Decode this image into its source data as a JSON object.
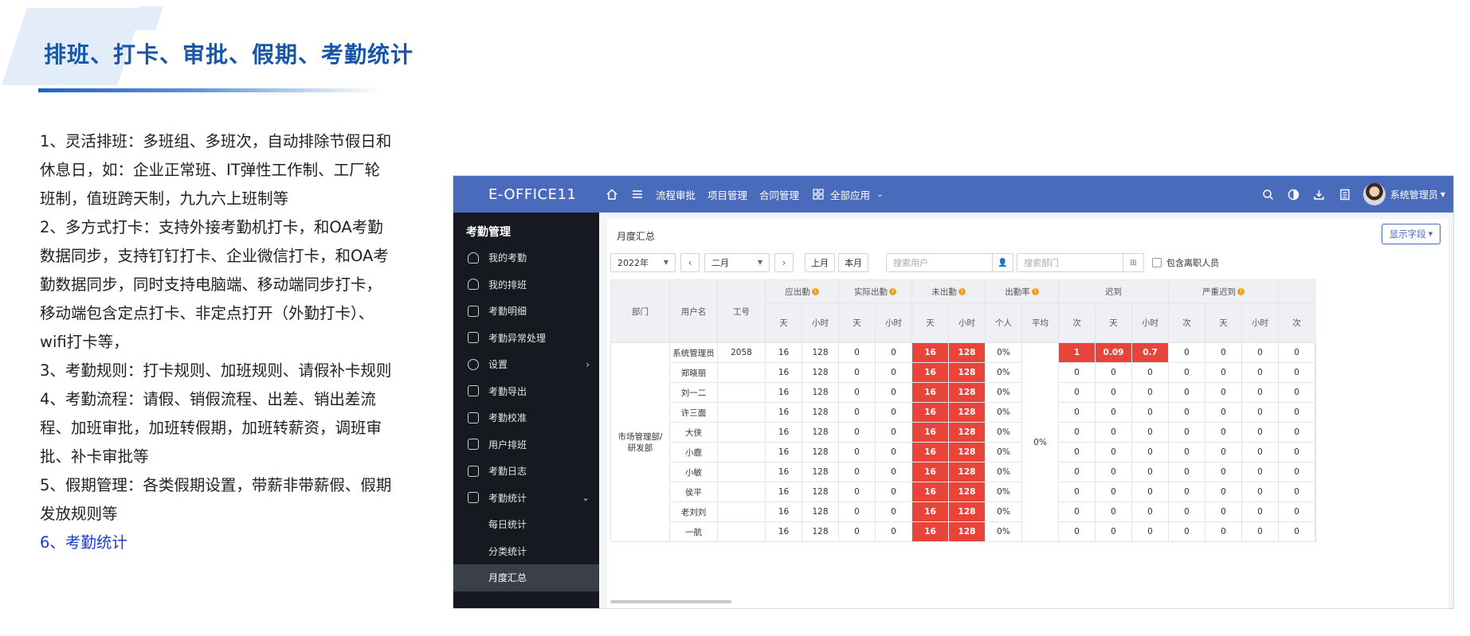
{
  "slide": {
    "title": "排班、打卡、审批、假期、考勤统计",
    "bullets": [
      "1、灵活排班：多班组、多班次，自动排除节假日和休息日，如：企业正常班、IT弹性工作制、工厂轮班制，值班跨天制，九九六上班制等",
      "2、多方式打卡：支持外接考勤机打卡，和OA考勤数据同步，支持钉钉打卡、企业微信打卡，和OA考勤数据同步，同时支持电脑端、移动端同步打卡，移动端包含定点打卡、非定点打开（外勤打卡）、wifi打卡等，",
      "3、考勤规则：打卡规则、加班规则、请假补卡规则",
      "4、考勤流程：请假、销假流程、出差、销出差流程、加班审批，加班转假期，加班转薪资，调班审批、补卡审批等",
      "5、假期管理：各类假期设置，带薪非带薪假、假期发放规则等",
      "6、考勤统计"
    ],
    "accent": "#1756a9",
    "active_color": "#1a3ccf"
  },
  "app": {
    "logo": "E-OFFICE11",
    "topbar_color": "#4a6bbb",
    "nav": [
      "流程审批",
      "项目管理",
      "合同管理"
    ],
    "all_apps": "全部应用",
    "user": "系统管理员",
    "sidebar": {
      "title": "考勤管理",
      "items": [
        {
          "label": "我的考勤",
          "icon": "user-icon"
        },
        {
          "label": "我的排班",
          "icon": "user-icon"
        },
        {
          "label": "考勤明细",
          "icon": "calendar-icon"
        },
        {
          "label": "考勤异常处理",
          "icon": "calendar-icon"
        },
        {
          "label": "设置",
          "icon": "gear-icon"
        },
        {
          "label": "考勤导出",
          "icon": "export-icon"
        },
        {
          "label": "考勤校准",
          "icon": "calendar-icon"
        },
        {
          "label": "用户排班",
          "icon": "calendar-icon"
        },
        {
          "label": "考勤日志",
          "icon": "log-icon"
        },
        {
          "label": "考勤统计",
          "icon": "calendar-icon"
        }
      ],
      "subitems": [
        "每日统计",
        "分类统计",
        "月度汇总"
      ]
    },
    "panel": {
      "title": "月度汇总",
      "show_fields": "显示字段",
      "year": "2022年",
      "month": "二月",
      "prev_month": "上月",
      "this_month": "本月",
      "search_user": "搜索用户",
      "search_dept": "搜索部门",
      "include_resigned": "包含离职人员"
    },
    "table": {
      "headers": {
        "dept": "部门",
        "username": "用户名",
        "emp_no": "工号",
        "should": "应出勤",
        "actual": "实际出勤",
        "absent": "未出勤",
        "rate": "出勤率",
        "late": "迟到",
        "serious_late": "严重迟到"
      },
      "subheaders": {
        "day": "天",
        "hour": "小时",
        "person": "个人",
        "avg": "平均",
        "times": "次"
      },
      "dept_value": "市场管理部/研发部",
      "avg_rate": "0%",
      "rows": [
        {
          "name": "系统管理员",
          "no": "2058",
          "c": [
            "16",
            "128",
            "0",
            "0",
            "16",
            "128",
            "0%",
            "1",
            "0.09",
            "0.7",
            "0",
            "0",
            "0",
            "0"
          ]
        },
        {
          "name": "郑晓丽",
          "no": "",
          "c": [
            "16",
            "128",
            "0",
            "0",
            "16",
            "128",
            "0%",
            "0",
            "0",
            "0",
            "0",
            "0",
            "0",
            "0"
          ]
        },
        {
          "name": "刘一二",
          "no": "",
          "c": [
            "16",
            "128",
            "0",
            "0",
            "16",
            "128",
            "0%",
            "0",
            "0",
            "0",
            "0",
            "0",
            "0",
            "0"
          ]
        },
        {
          "name": "许三面",
          "no": "",
          "c": [
            "16",
            "128",
            "0",
            "0",
            "16",
            "128",
            "0%",
            "0",
            "0",
            "0",
            "0",
            "0",
            "0",
            "0"
          ]
        },
        {
          "name": "大侠",
          "no": "",
          "c": [
            "16",
            "128",
            "0",
            "0",
            "16",
            "128",
            "0%",
            "0",
            "0",
            "0",
            "0",
            "0",
            "0",
            "0"
          ]
        },
        {
          "name": "小鹿",
          "no": "",
          "c": [
            "16",
            "128",
            "0",
            "0",
            "16",
            "128",
            "0%",
            "0",
            "0",
            "0",
            "0",
            "0",
            "0",
            "0"
          ]
        },
        {
          "name": "小敏",
          "no": "",
          "c": [
            "16",
            "128",
            "0",
            "0",
            "16",
            "128",
            "0%",
            "0",
            "0",
            "0",
            "0",
            "0",
            "0",
            "0"
          ]
        },
        {
          "name": "侯平",
          "no": "",
          "c": [
            "16",
            "128",
            "0",
            "0",
            "16",
            "128",
            "0%",
            "0",
            "0",
            "0",
            "0",
            "0",
            "0",
            "0"
          ]
        },
        {
          "name": "老刘刘",
          "no": "",
          "c": [
            "16",
            "128",
            "0",
            "0",
            "16",
            "128",
            "0%",
            "0",
            "0",
            "0",
            "0",
            "0",
            "0",
            "0"
          ]
        },
        {
          "name": "一航",
          "no": "",
          "c": [
            "16",
            "128",
            "0",
            "0",
            "16",
            "128",
            "0%",
            "0",
            "0",
            "0",
            "0",
            "0",
            "0",
            "0"
          ]
        }
      ],
      "highlight_color": "#e8443a"
    }
  }
}
